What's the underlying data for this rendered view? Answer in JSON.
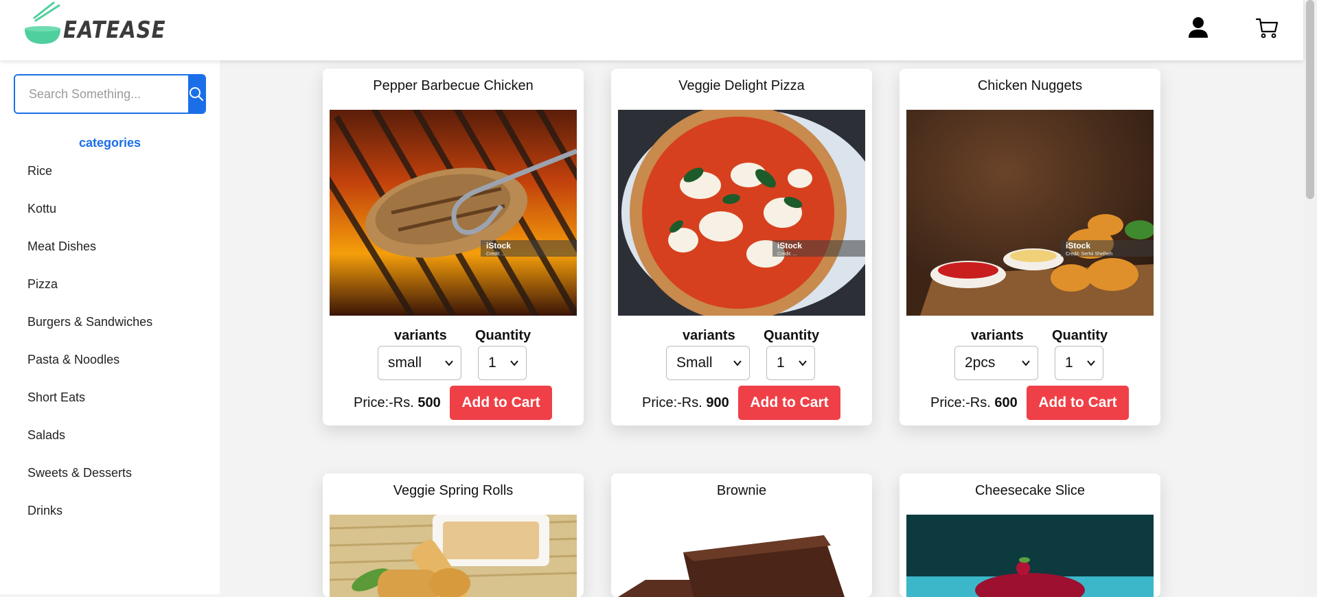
{
  "header": {
    "brand": "EATEASE",
    "icons": [
      "user-icon",
      "cart-icon"
    ]
  },
  "sidebar": {
    "search_placeholder": "Search Something...",
    "categories_title": "categories",
    "categories": [
      "Rice",
      "Kottu",
      "Meat Dishes",
      "Pizza",
      "Burgers & Sandwiches",
      "Pasta & Noodles",
      "Short Eats",
      "Salads",
      "Sweets & Desserts",
      "Drinks"
    ]
  },
  "labels": {
    "variants": "variants",
    "quantity": "Quantity",
    "price_prefix": "Price:-Rs. ",
    "add_to_cart": "Add to Cart"
  },
  "products": [
    {
      "name": "Pepper Barbecue Chicken",
      "variant": "small",
      "quantity": "1",
      "price": "500",
      "photo_credit": "Credit: ..."
    },
    {
      "name": "Veggie Delight Pizza",
      "variant": "Small",
      "quantity": "1",
      "price": "900",
      "photo_credit": "Credit: ..."
    },
    {
      "name": "Chicken Nuggets",
      "variant": "2pcs",
      "quantity": "1",
      "price": "600",
      "photo_credit": "Credit: Serhii Shelheh"
    },
    {
      "name": "Veggie Spring Rolls"
    },
    {
      "name": "Brownie"
    },
    {
      "name": "Cheesecake Slice"
    }
  ],
  "colors": {
    "accent": "#1a6fe8",
    "cart_button": "#ef4047",
    "logo_bowl": "#4fcf9d"
  }
}
